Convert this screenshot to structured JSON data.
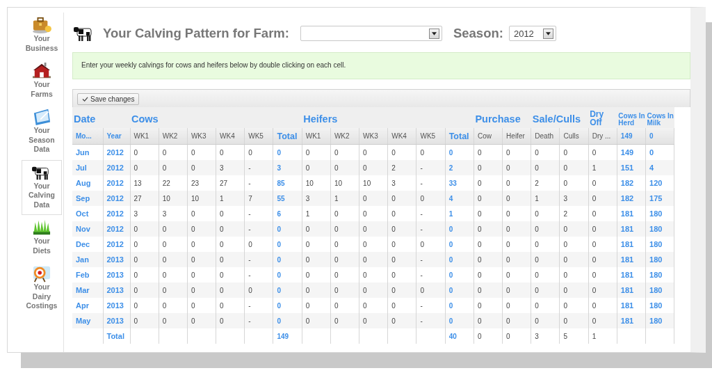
{
  "sidebar": {
    "items": [
      {
        "label": "Your Business",
        "selected": false
      },
      {
        "label": "Your Farms",
        "selected": false
      },
      {
        "label": "Your Season Data",
        "selected": false
      },
      {
        "label": "Your Calving Data",
        "selected": true
      },
      {
        "label": "Your Diets",
        "selected": false
      },
      {
        "label": "Your Dairy Costings",
        "selected": false
      }
    ]
  },
  "header": {
    "title": "Your Calving Pattern for Farm:",
    "season_label": "Season:",
    "season_select": {
      "value": "2012"
    }
  },
  "info": "Enter your weekly calvings for cows and heifers below by double clicking on each cell.",
  "toolbar": {
    "save_button": "Save changes"
  },
  "table": {
    "groups": [
      {
        "label": "Date",
        "kind": "large",
        "columns": [
          {
            "label": "Mo...",
            "kind": "key"
          },
          {
            "label": "Year",
            "kind": "key"
          }
        ]
      },
      {
        "label": "Cows",
        "kind": "large",
        "columns": [
          {
            "label": "WK1",
            "kind": "value"
          },
          {
            "label": "WK2",
            "kind": "value"
          },
          {
            "label": "WK3",
            "kind": "value"
          },
          {
            "label": "WK4",
            "kind": "value"
          },
          {
            "label": "WK5",
            "kind": "value"
          },
          {
            "label": "Total",
            "kind": "total"
          }
        ]
      },
      {
        "label": "Heifers",
        "kind": "large",
        "columns": [
          {
            "label": "WK1",
            "kind": "value"
          },
          {
            "label": "WK2",
            "kind": "value"
          },
          {
            "label": "WK3",
            "kind": "value"
          },
          {
            "label": "WK4",
            "kind": "value"
          },
          {
            "label": "WK5",
            "kind": "value"
          },
          {
            "label": "Total",
            "kind": "total"
          }
        ]
      },
      {
        "label": "Purchase",
        "kind": "large",
        "columns": [
          {
            "label": "Cow",
            "kind": "value"
          },
          {
            "label": "Heifer",
            "kind": "value"
          }
        ]
      },
      {
        "label": "Sale/Culls",
        "kind": "large",
        "columns": [
          {
            "label": "Death",
            "kind": "value"
          },
          {
            "label": "Culls",
            "kind": "value"
          }
        ]
      },
      {
        "label": "Dry Off",
        "kind": "medium",
        "columns": [
          {
            "label": "Dry ...",
            "kind": "value"
          }
        ]
      },
      {
        "label": "Cows In Herd",
        "kind": "small",
        "columns": [
          {
            "label": "149",
            "kind": "key"
          }
        ]
      },
      {
        "label": "Cows In Milk",
        "kind": "small",
        "columns": [
          {
            "label": "0",
            "kind": "key"
          }
        ]
      }
    ],
    "rows": [
      [
        "Jun",
        "2012",
        "0",
        "0",
        "0",
        "0",
        "0",
        "0",
        "0",
        "0",
        "0",
        "0",
        "0",
        "0",
        "0",
        "0",
        "0",
        "0",
        "0",
        "149",
        "0"
      ],
      [
        "Jul",
        "2012",
        "0",
        "0",
        "0",
        "3",
        "-",
        "3",
        "0",
        "0",
        "0",
        "2",
        "-",
        "2",
        "0",
        "0",
        "0",
        "0",
        "1",
        "151",
        "4"
      ],
      [
        "Aug",
        "2012",
        "13",
        "22",
        "23",
        "27",
        "-",
        "85",
        "10",
        "10",
        "10",
        "3",
        "-",
        "33",
        "0",
        "0",
        "2",
        "0",
        "0",
        "182",
        "120"
      ],
      [
        "Sep",
        "2012",
        "27",
        "10",
        "10",
        "1",
        "7",
        "55",
        "3",
        "1",
        "0",
        "0",
        "0",
        "4",
        "0",
        "0",
        "1",
        "3",
        "0",
        "182",
        "175"
      ],
      [
        "Oct",
        "2012",
        "3",
        "3",
        "0",
        "0",
        "-",
        "6",
        "1",
        "0",
        "0",
        "0",
        "-",
        "1",
        "0",
        "0",
        "0",
        "2",
        "0",
        "181",
        "180"
      ],
      [
        "Nov",
        "2012",
        "0",
        "0",
        "0",
        "0",
        "-",
        "0",
        "0",
        "0",
        "0",
        "0",
        "-",
        "0",
        "0",
        "0",
        "0",
        "0",
        "0",
        "181",
        "180"
      ],
      [
        "Dec",
        "2012",
        "0",
        "0",
        "0",
        "0",
        "0",
        "0",
        "0",
        "0",
        "0",
        "0",
        "0",
        "0",
        "0",
        "0",
        "0",
        "0",
        "0",
        "181",
        "180"
      ],
      [
        "Jan",
        "2013",
        "0",
        "0",
        "0",
        "0",
        "-",
        "0",
        "0",
        "0",
        "0",
        "0",
        "-",
        "0",
        "0",
        "0",
        "0",
        "0",
        "0",
        "181",
        "180"
      ],
      [
        "Feb",
        "2013",
        "0",
        "0",
        "0",
        "0",
        "-",
        "0",
        "0",
        "0",
        "0",
        "0",
        "-",
        "0",
        "0",
        "0",
        "0",
        "0",
        "0",
        "181",
        "180"
      ],
      [
        "Mar",
        "2013",
        "0",
        "0",
        "0",
        "0",
        "0",
        "0",
        "0",
        "0",
        "0",
        "0",
        "0",
        "0",
        "0",
        "0",
        "0",
        "0",
        "0",
        "181",
        "180"
      ],
      [
        "Apr",
        "2013",
        "0",
        "0",
        "0",
        "0",
        "-",
        "0",
        "0",
        "0",
        "0",
        "0",
        "-",
        "0",
        "0",
        "0",
        "0",
        "0",
        "0",
        "181",
        "180"
      ],
      [
        "May",
        "2013",
        "0",
        "0",
        "0",
        "0",
        "-",
        "0",
        "0",
        "0",
        "0",
        "0",
        "-",
        "0",
        "0",
        "0",
        "0",
        "0",
        "0",
        "181",
        "180"
      ],
      [
        null,
        "Total",
        null,
        null,
        null,
        null,
        null,
        "149",
        null,
        null,
        null,
        null,
        null,
        "40",
        "0",
        "0",
        "3",
        "5",
        "1",
        null,
        null
      ]
    ]
  }
}
